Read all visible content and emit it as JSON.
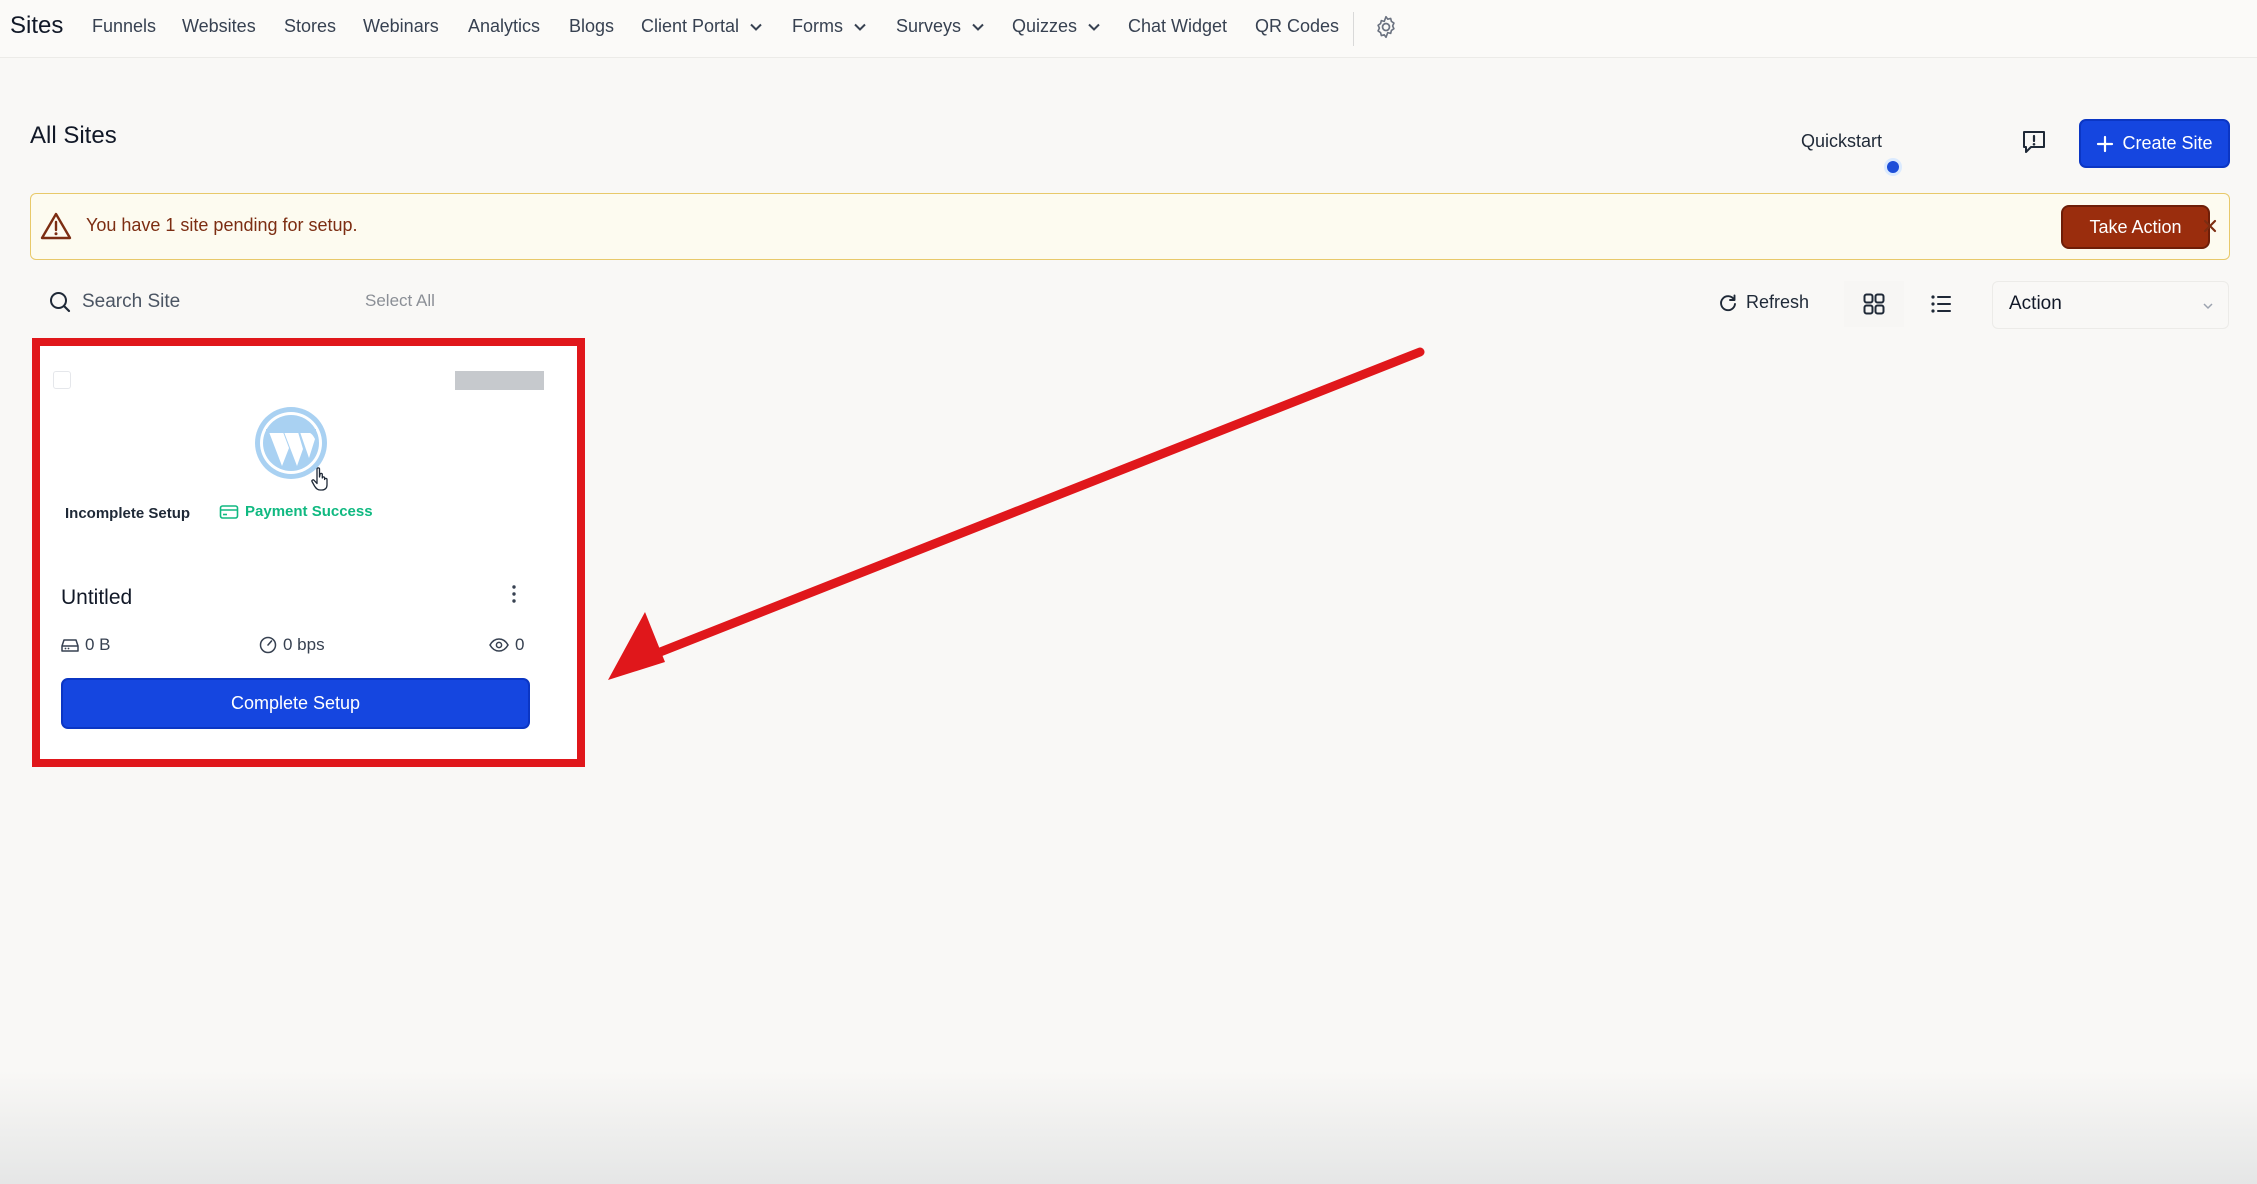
{
  "nav": {
    "brand": "Sites",
    "items": [
      {
        "label": "Funnels"
      },
      {
        "label": "Websites"
      },
      {
        "label": "Stores"
      },
      {
        "label": "Webinars"
      },
      {
        "label": "Analytics"
      },
      {
        "label": "Blogs"
      },
      {
        "label": "Client Portal",
        "dropdown": true
      },
      {
        "label": "Forms",
        "dropdown": true
      },
      {
        "label": "Surveys",
        "dropdown": true
      },
      {
        "label": "Quizzes",
        "dropdown": true
      },
      {
        "label": "Chat Widget"
      },
      {
        "label": "QR Codes"
      }
    ],
    "settings_icon": "gear-icon"
  },
  "header": {
    "title": "All Sites",
    "quickstart_label": "Quickstart",
    "create_label": "Create Site"
  },
  "alert": {
    "message": "You have 1 site pending for setup.",
    "action_label": "Take Action"
  },
  "toolbar": {
    "search_placeholder": "Search Site",
    "select_all": "Select All",
    "refresh_label": "Refresh",
    "action_label": "Action"
  },
  "site_card": {
    "name": "Untitled",
    "status": "Incomplete Setup",
    "payment_status": "Payment Success",
    "storage": "0 B",
    "bandwidth": "0 bps",
    "views": "0",
    "button_label": "Complete Setup"
  },
  "colors": {
    "primary": "#1546e0",
    "alert_action": "#9a2d0d",
    "success": "#10b981",
    "annotation": "#e0171b"
  }
}
